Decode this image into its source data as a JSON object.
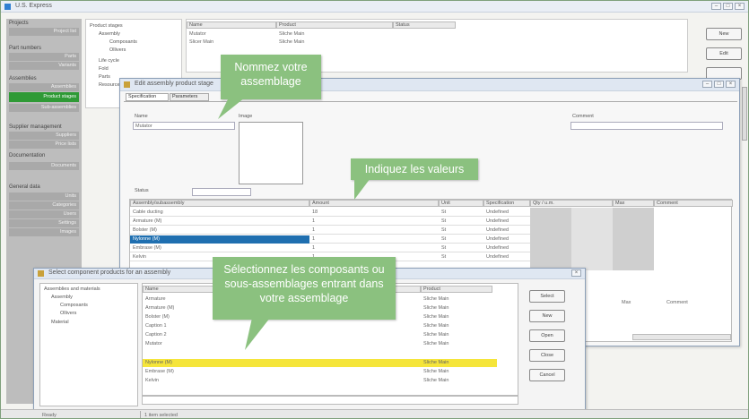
{
  "main_window": {
    "title": "U.S. Express"
  },
  "right_buttons": [
    "New",
    "Edit"
  ],
  "sidebar": {
    "sections": [
      {
        "head": "Projects",
        "items": [
          "Project list"
        ]
      },
      {
        "head": "Part numbers",
        "items": [
          "Parts",
          "Variants"
        ]
      },
      {
        "head": "Assemblies",
        "items": [
          "Assemblies",
          "Product stages",
          "Sub-assemblies"
        ]
      },
      {
        "head": "Supplier management",
        "items": [
          "Suppliers",
          "Price lists"
        ]
      },
      {
        "head": "Documentation",
        "items": [
          "Documents"
        ]
      },
      {
        "head": "General data",
        "items": [
          "Units",
          "Categories",
          "Users",
          "Settings",
          "Images"
        ]
      }
    ],
    "active": "Product stages"
  },
  "tree": [
    "Product stages",
    "Assembly",
    "Composants",
    "Ollivers",
    "Life cycle",
    "Fold",
    "Parts",
    "Resources"
  ],
  "top_grid": {
    "headers": [
      "Name",
      "Product",
      "Status"
    ],
    "rows": [
      [
        "Mutator",
        "Sliche Main"
      ],
      [
        "Slicer Main",
        "Sliche Main"
      ]
    ]
  },
  "edit_window": {
    "title": "Edit assembly product stage",
    "tabs": [
      "Specification",
      "Parameters"
    ],
    "name_label": "Name",
    "name_value": "Mutator",
    "image_label": "Image",
    "status_label": "Status",
    "comment_label": "Comment",
    "columns": [
      "Assembly/subassembly",
      "Amount",
      "Unit",
      "Specification",
      "Qty / u.m.",
      "Max",
      "Comment"
    ],
    "rows": [
      [
        "Cable ducting",
        "18",
        "St",
        "Undefined"
      ],
      [
        "Armature (M)",
        "1",
        "St",
        "Undefined"
      ],
      [
        "Bolster (M)",
        "1",
        "St",
        "Undefined"
      ],
      [
        "Nylonne (M)",
        "1",
        "St",
        "Undefined"
      ],
      [
        "Embrase (M)",
        "1",
        "St",
        "Undefined"
      ],
      [
        "Kelvin",
        "1",
        "St",
        "Undefined"
      ]
    ],
    "selected_row": 3
  },
  "select_window": {
    "title": "Select component products for an assembly",
    "tree": [
      "Assemblies and materials",
      "Assembly",
      "Composants",
      "Ollivers",
      "Material"
    ],
    "columns": [
      "Name",
      "Product"
    ],
    "rows": [
      [
        "Armature",
        "Sliche Main"
      ],
      [
        "Armature (M)",
        "Sliche Main"
      ],
      [
        "Bolster (M)",
        "Sliche Main"
      ],
      [
        "Caption 1",
        "Sliche Main"
      ],
      [
        "Caption 2",
        "Sliche Main"
      ],
      [
        "Mutator",
        "Sliche Main"
      ],
      [
        "Nylonne (M)",
        "Sliche Main"
      ],
      [
        "Embrase (M)",
        "Sliche Main"
      ],
      [
        "Kelvin",
        "Sliche Main"
      ]
    ],
    "highlighted_row": 6,
    "buttons": [
      "Select",
      "New",
      "Open",
      "Close",
      "Cancel"
    ],
    "status_left": "Ready",
    "status_right": "1 item selected"
  },
  "callouts": {
    "name": "Nommez votre assemblage",
    "values": "Indiquez les valeurs",
    "components": "Sélectionnez les composants ou sous-assemblages entrant dans votre assemblage"
  },
  "colors": {
    "callout": "#8bc17f",
    "sidebar_active": "#2f9a36",
    "selected_row": "#1f6fb0",
    "highlight_row": "#f5e53a"
  }
}
